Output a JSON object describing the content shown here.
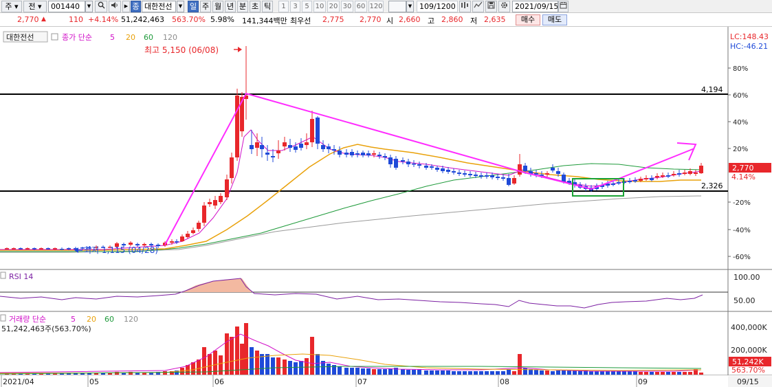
{
  "toolbar": {
    "mode": "주",
    "market": "전",
    "code": "001440",
    "stock_tag": "종",
    "stock_name": "대한전선",
    "periods": [
      "일",
      "주",
      "월",
      "년",
      "분",
      "초",
      "틱"
    ],
    "selected_period": "일",
    "intervals": [
      "1",
      "3",
      "5",
      "10",
      "20",
      "30",
      "60",
      "120"
    ],
    "count": "109/1200",
    "date": "2021/09/15"
  },
  "quote": {
    "price": "2,770",
    "change": "110",
    "change_pct": "+4.14%",
    "volume": "51,242,463",
    "volume_ratio": "563.70%",
    "turnover": "5.98%",
    "amount": "141,344백만",
    "best_ask_label": "최우선",
    "best_ask": "2,775",
    "best_bid": "2,770",
    "open_label": "시",
    "open": "2,660",
    "high_label": "고",
    "high": "2,860",
    "low_label": "저",
    "low": "2,635",
    "buy_label": "매수",
    "sell_label": "매도"
  },
  "colors": {
    "up": "#e8272b",
    "down": "#1f4ad8",
    "ma5": "#d10fc8",
    "ma20": "#e9a10a",
    "ma60": "#1e9a3a",
    "ma120": "#8c8c8c",
    "trend": "#ff2cff"
  },
  "price_panel": {
    "legend_name": "대한전선",
    "legend_type": "종가 단순",
    "ma_periods": [
      "5",
      "20",
      "60",
      "120"
    ],
    "high_note": "최고 5,150 (06/08)",
    "low_note": "최저 1,115 (04/28)",
    "level_upper": "4,194",
    "level_lower": "2,326",
    "lc_label": "LC:148.43",
    "hc_label": "HC:-46.21",
    "current_price": "2,770",
    "current_change": "4.14%",
    "y_ticks": [
      "80%",
      "60%",
      "40%",
      "20%",
      "-20%",
      "-40%",
      "-60%"
    ]
  },
  "rsi_panel": {
    "label": "RSI 14",
    "y_ticks": [
      "100.00",
      "50.00"
    ]
  },
  "volume_panel": {
    "label": "거래량 단순",
    "ma_periods": [
      "5",
      "20",
      "60",
      "120"
    ],
    "value_label": "51,242,463주(563.70%)",
    "y_ticks": [
      "400,000K",
      "200,000K"
    ],
    "current_volume": "51,242K",
    "current_ratio": "563.70%"
  },
  "x_axis": {
    "labels": [
      "2021/04",
      "05",
      "06",
      "07",
      "08",
      "09"
    ],
    "current_date": "09/15"
  }
}
